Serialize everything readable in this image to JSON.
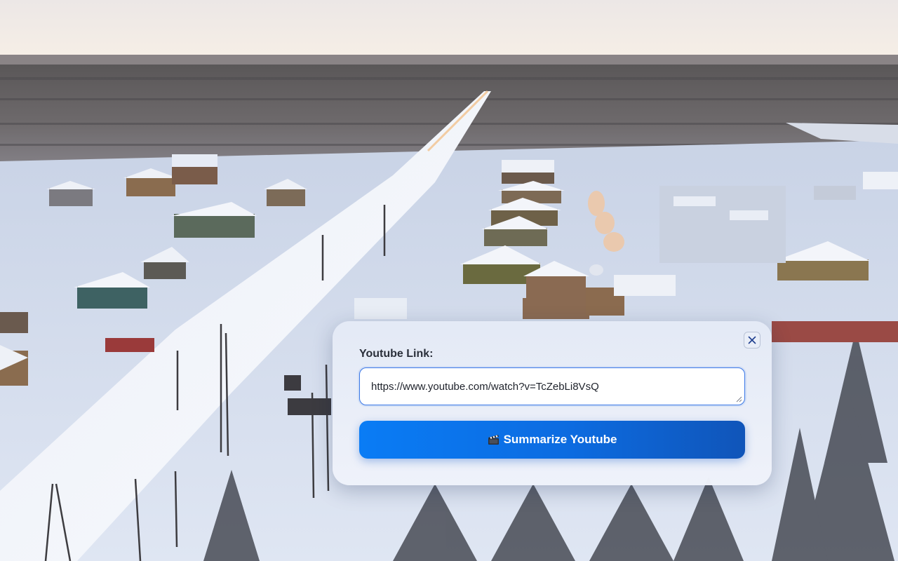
{
  "background": {
    "description_icon": "snowy-village-aerial-photo"
  },
  "dialog": {
    "label": "Youtube Link:",
    "url_value": "https://www.youtube.com/watch?v=TcZebLi8VsQ",
    "button_label": "Summarize Youtube",
    "button_icon": "clapperboard-icon",
    "close_icon": "close-icon",
    "accent_color": "#0a7cf5"
  }
}
